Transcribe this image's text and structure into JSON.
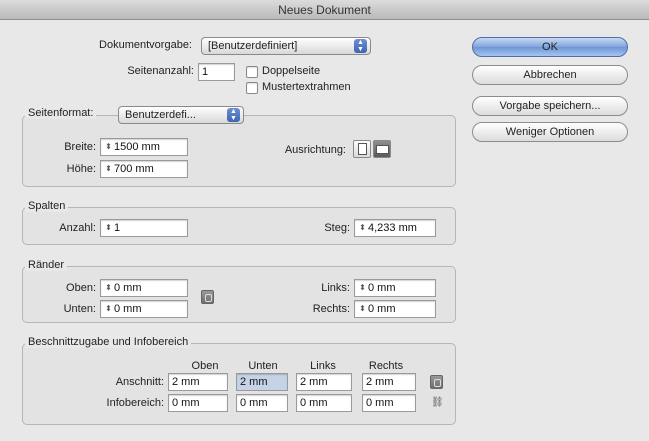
{
  "window": {
    "title": "Neues Dokument"
  },
  "preset": {
    "label": "Dokumentvorgabe:",
    "value": "[Benutzerdefiniert]"
  },
  "pages": {
    "label": "Seitenanzahl:",
    "value": "1"
  },
  "facing_pages": {
    "label": "Doppelseite",
    "checked": false
  },
  "master_text_frame": {
    "label": "Mustertextrahmen",
    "checked": false
  },
  "page_size": {
    "label": "Seitenformat:",
    "value": "Benutzerdefi...",
    "width_label": "Breite:",
    "width_value": "1500 mm",
    "height_label": "Höhe:",
    "height_value": "700 mm",
    "orientation_label": "Ausrichtung:",
    "orientation_selected": "landscape"
  },
  "columns": {
    "title": "Spalten",
    "number_label": "Anzahl:",
    "number_value": "1",
    "gutter_label": "Steg:",
    "gutter_value": "4,233 mm"
  },
  "margins": {
    "title": "Ränder",
    "top_label": "Oben:",
    "top_value": "0 mm",
    "bottom_label": "Unten:",
    "bottom_value": "0 mm",
    "left_label": "Links:",
    "left_value": "0 mm",
    "right_label": "Rechts:",
    "right_value": "0 mm"
  },
  "bleed": {
    "title": "Beschnittzugabe und Infobereich",
    "col_headers": [
      "Oben",
      "Unten",
      "Links",
      "Rechts"
    ],
    "bleed_label": "Anschnitt:",
    "bleed_values": [
      "2 mm",
      "2 mm",
      "2 mm",
      "2 mm"
    ],
    "slug_label": "Infobereich:",
    "slug_values": [
      "0 mm",
      "0 mm",
      "0 mm",
      "0 mm"
    ]
  },
  "buttons": {
    "ok": "OK",
    "cancel": "Abbrechen",
    "save_preset": "Vorgabe speichern...",
    "fewer_options": "Weniger Optionen"
  }
}
